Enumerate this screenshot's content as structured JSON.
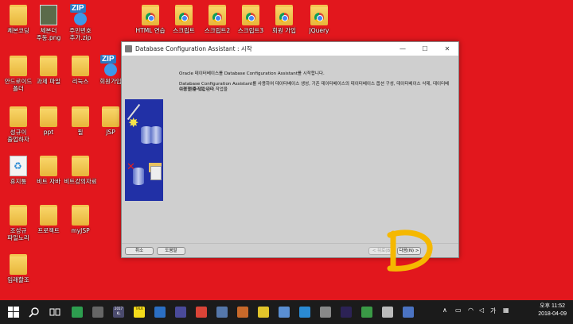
{
  "desktop": {
    "icons": [
      {
        "label": "체본코딩",
        "kind": "folder"
      },
      {
        "label": "체본더",
        "label2": "주동.png",
        "kind": "photo"
      },
      {
        "label": "주민번호",
        "label2": "추가.zip",
        "kind": "zip"
      },
      {
        "label": "HTML 연습",
        "kind": "chrome"
      },
      {
        "label": "스크립트",
        "kind": "chrome"
      },
      {
        "label": "스크립트2",
        "kind": "chrome"
      },
      {
        "label": "스크립트3",
        "kind": "chrome"
      },
      {
        "label": "회원 가입",
        "kind": "chrome"
      },
      {
        "label": "JQuery",
        "kind": "chrome"
      },
      {
        "label": "안드로이드",
        "label2": "폴더",
        "kind": "folder"
      },
      {
        "label": "과제 파일",
        "kind": "folder"
      },
      {
        "label": "리눅스",
        "kind": "folder"
      },
      {
        "label": "회원가입",
        "kind": "zip"
      },
      {
        "label": "성규이",
        "label2": "출업하자",
        "kind": "folder"
      },
      {
        "label": "ppt",
        "kind": "folder"
      },
      {
        "label": "필",
        "kind": "folder"
      },
      {
        "label": "JSP",
        "kind": "folder"
      },
      {
        "label": "휴지통",
        "kind": "recycle"
      },
      {
        "label": "비트 자바",
        "kind": "folder"
      },
      {
        "label": "비트강의자료",
        "kind": "folder"
      },
      {
        "label": "조성규",
        "label2": "파일노리",
        "kind": "folder"
      },
      {
        "label": "프로젝트",
        "kind": "folder"
      },
      {
        "label": "myJSP",
        "kind": "folder"
      },
      {
        "label": "임래할조",
        "kind": "folder"
      }
    ]
  },
  "window": {
    "title": "Database Configuration Assistant : 시작",
    "minimize": "—",
    "maximize": "☐",
    "close": "✕",
    "message_line1": "Oracle 데이터베이스를 Database Configuration Assistant를 시작합니다.",
    "message_line2": "Database Configuration Assistant를 사용하여 데이터베이스 생성, 기존 데이터베이스의 데이터베이스 옵션 구성, 데이터베이스 삭제, 데이터베이스 템플리트 관리 작업을",
    "message_line3": "수행할 수 있습니다.",
    "buttons": {
      "cancel": "취소",
      "help": "도움말",
      "back": "< 뒤로(B)",
      "next": "다음(N)",
      "next_arrow": ">"
    }
  },
  "annotation": {
    "letter": "D",
    "color": "#f5b800"
  },
  "taskbar": {
    "start_icon": "windows-logo-icon",
    "search_icon": "search-icon",
    "task_view_icon": "task-view-icon",
    "apps": [
      {
        "name": "app-green-icon",
        "color": "#2d9e4f"
      },
      {
        "name": "app-disc-icon",
        "color": "#666666"
      },
      {
        "name": "app-vs2017-icon",
        "color": "#4b4b6e",
        "text": "2017 KL"
      },
      {
        "name": "app-kakao-icon",
        "color": "#f5dc1b",
        "text": "TALK"
      },
      {
        "name": "app-folder-icon",
        "color": "#2b6fc4"
      },
      {
        "name": "app-text-icon",
        "color": "#4a4a9a"
      },
      {
        "name": "chrome-icon",
        "color": "#db4437"
      },
      {
        "name": "app-media-icon",
        "color": "#5577aa"
      },
      {
        "name": "app-orange-icon",
        "color": "#c8692a"
      },
      {
        "name": "app-notes-icon",
        "color": "#e2c42a"
      },
      {
        "name": "app-monitor-icon",
        "color": "#5a8fd3"
      },
      {
        "name": "ie-icon",
        "color": "#2a8ad4"
      },
      {
        "name": "app-headset-icon",
        "color": "#888888"
      },
      {
        "name": "app-eclipse-icon",
        "color": "#2c2255"
      },
      {
        "name": "app-green2-icon",
        "color": "#3a9a46"
      },
      {
        "name": "settings-icon",
        "color": "#bbbbbb"
      },
      {
        "name": "app-shield-icon",
        "color": "#4b73c2"
      }
    ],
    "tray": {
      "chevron": "∧",
      "ime": "가",
      "time": "오후 11:52",
      "date": "2018-04-09"
    }
  }
}
